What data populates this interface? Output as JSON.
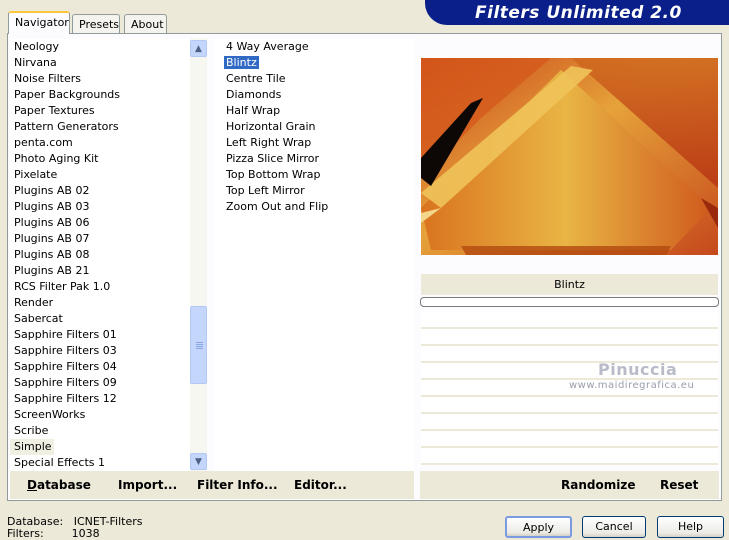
{
  "app": {
    "title": "Filters Unlimited 2.0"
  },
  "tabs": [
    {
      "label": "Navigator",
      "active": true
    },
    {
      "label": "Presets",
      "active": false
    },
    {
      "label": "About",
      "active": false
    }
  ],
  "categories": [
    "Neology",
    "Nirvana",
    "Noise Filters",
    "Paper Backgrounds",
    "Paper Textures",
    "Pattern Generators",
    "penta.com",
    "Photo Aging Kit",
    "Pixelate",
    "Plugins AB 02",
    "Plugins AB 03",
    "Plugins AB 06",
    "Plugins AB 07",
    "Plugins AB 08",
    "Plugins AB 21",
    "RCS Filter Pak 1.0",
    "Render",
    "Sabercat",
    "Sapphire Filters 01",
    "Sapphire Filters 03",
    "Sapphire Filters 04",
    "Sapphire Filters 09",
    "Sapphire Filters 12",
    "ScreenWorks",
    "Scribe",
    "Simple",
    "Special Effects 1"
  ],
  "selected_category": "Simple",
  "filters": [
    "4 Way Average",
    "Blintz",
    "Centre Tile",
    "Diamonds",
    "Half Wrap",
    "Horizontal Grain",
    "Left Right Wrap",
    "Pizza Slice Mirror",
    "Top Bottom Wrap",
    "Top Left Mirror",
    "Zoom Out and Flip"
  ],
  "selected_filter": "Blintz",
  "bottom_bar": {
    "database": "Database",
    "import": "Import...",
    "filter_info": "Filter Info...",
    "editor": "Editor...",
    "randomize": "Randomize",
    "reset": "Reset"
  },
  "preview": {
    "filter_label": "Blintz"
  },
  "watermark": {
    "name": "Pinuccia",
    "url": "www.maidiregrafica.eu"
  },
  "status": {
    "database_label": "Database:",
    "database_value": "ICNET-Filters",
    "filters_label": "Filters:",
    "filters_value": "1038"
  },
  "buttons": {
    "apply": "Apply",
    "cancel": "Cancel",
    "help": "Help"
  },
  "colors": {
    "banner": "#0a1f8a",
    "selection": "#316ac5",
    "active_tab_accent": "#ffc83c"
  }
}
